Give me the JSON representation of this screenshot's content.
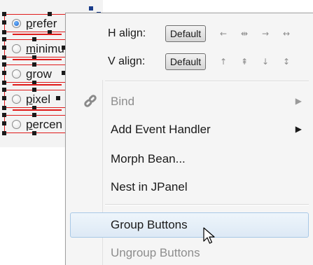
{
  "canvas": {
    "radios": [
      {
        "mnemonic": "p",
        "rest": "refer",
        "checked": true
      },
      {
        "mnemonic": "m",
        "rest": "inimu",
        "checked": false
      },
      {
        "mnemonic": "g",
        "rest": "row",
        "checked": false
      },
      {
        "mnemonic": "p",
        "rest": "ixel",
        "checked": false
      },
      {
        "mnemonic": "p",
        "rest": "ercen",
        "checked": false
      }
    ]
  },
  "menu": {
    "h_align": {
      "label": "H align:",
      "button": "Default",
      "icons": [
        "←",
        "⇹",
        "→",
        "↔"
      ],
      "icon_names": [
        "left",
        "center",
        "right",
        "fill"
      ]
    },
    "v_align": {
      "label": "V align:",
      "button": "Default",
      "icons": [
        "↑",
        "⇞",
        "↓",
        "↕"
      ],
      "icon_names": [
        "top",
        "center",
        "bottom",
        "fill"
      ]
    },
    "items": [
      {
        "label": "Bind",
        "disabled": true,
        "submenu": true,
        "icon": "chain-link-icon"
      },
      {
        "label": "Add Event Handler",
        "disabled": false,
        "submenu": true
      },
      {
        "label": "Morph Bean...",
        "disabled": false,
        "submenu": false
      },
      {
        "label": "Nest in JPanel",
        "disabled": false,
        "submenu": false
      }
    ],
    "group_items": [
      {
        "label": "Group Buttons",
        "disabled": false,
        "highlighted": true
      },
      {
        "label": "Ungroup Buttons",
        "disabled": true,
        "highlighted": false
      }
    ],
    "submenu_arrow": "▶"
  },
  "colors": {
    "selection_border": "#e01b1b",
    "highlight_bg": "#dde9f5",
    "highlight_border": "#a8c8e6",
    "disabled_text": "#8d8d8d"
  }
}
